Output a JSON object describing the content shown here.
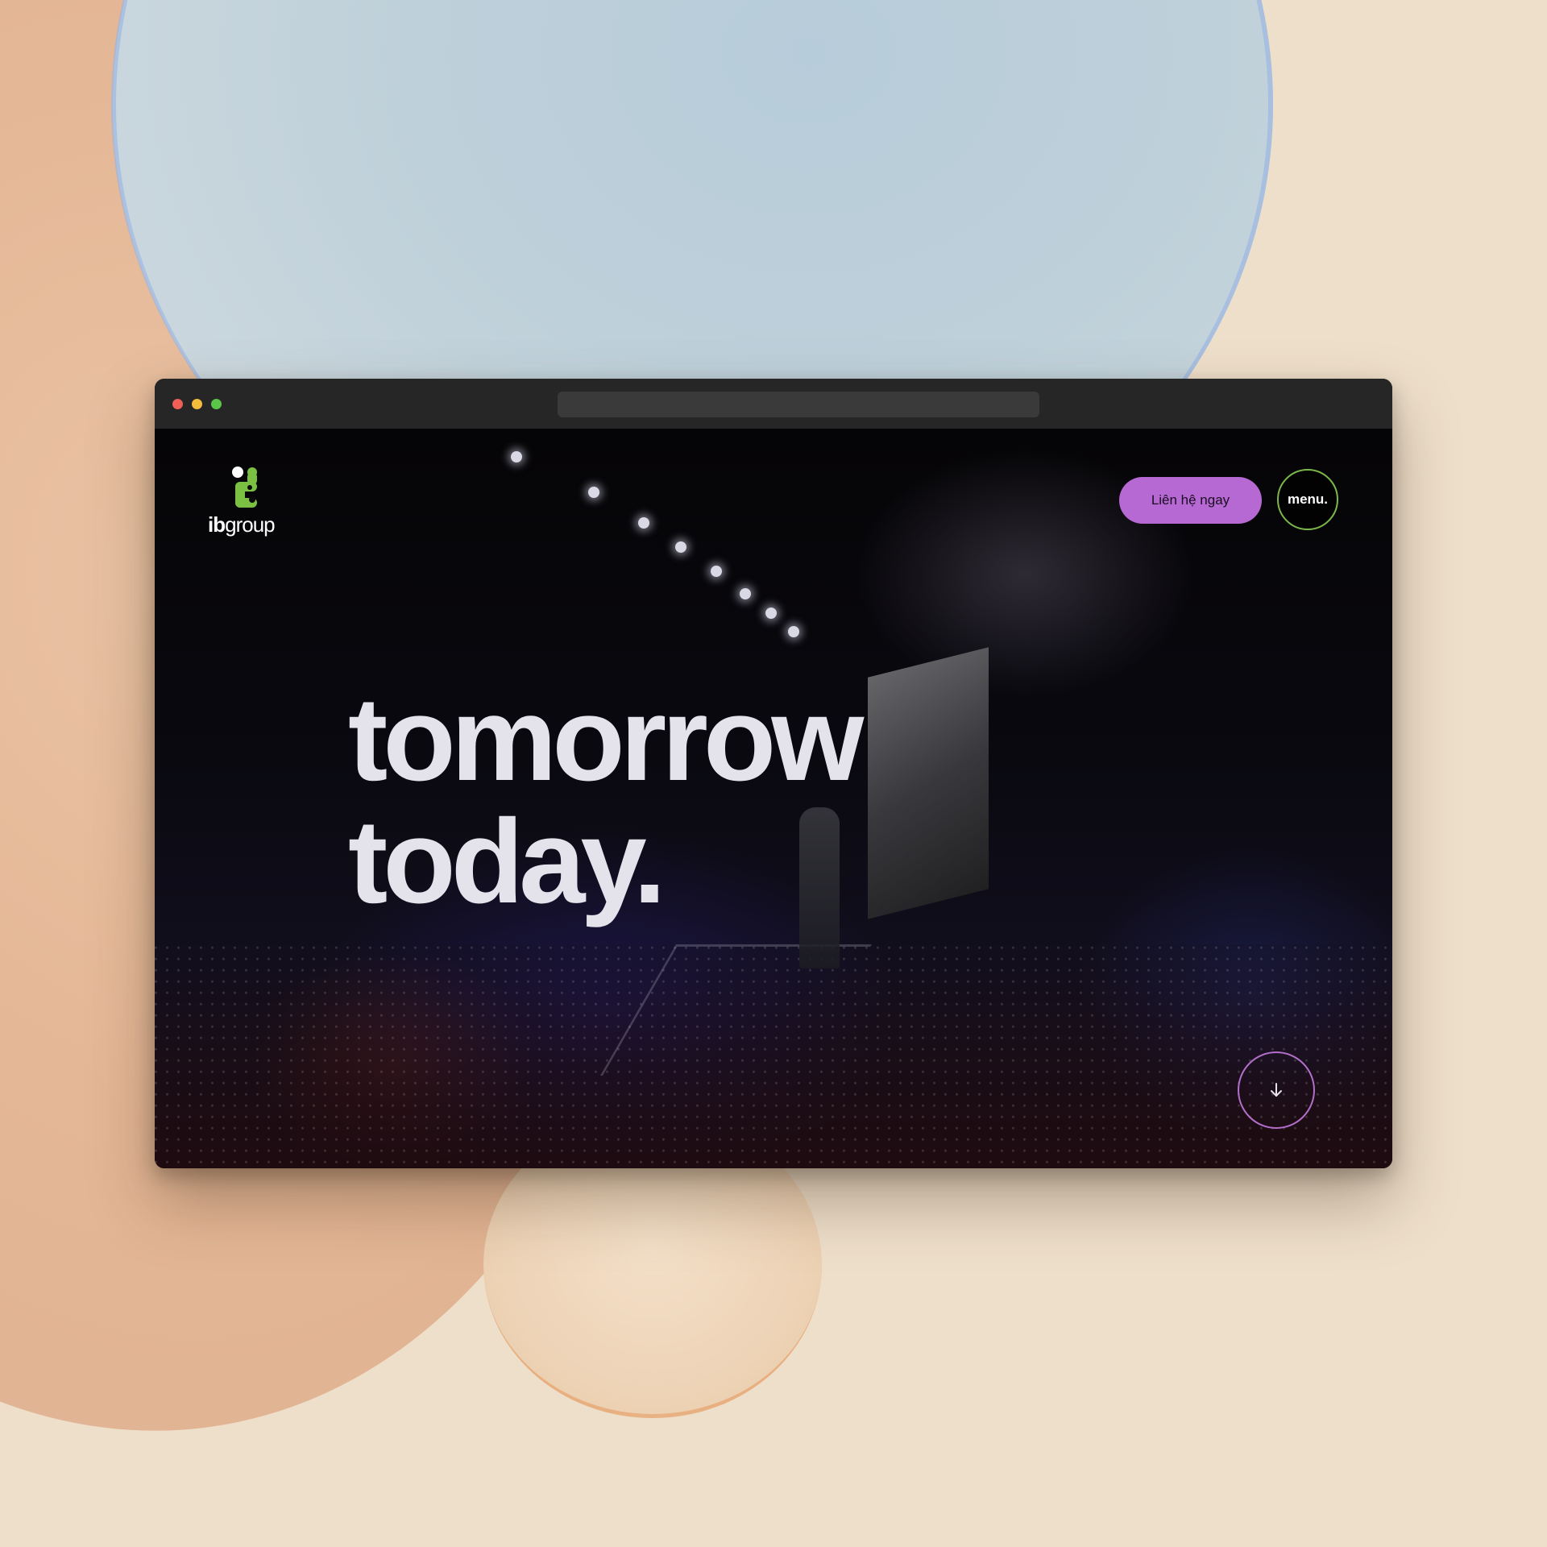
{
  "page": {
    "logo": {
      "mark_colors": {
        "white": "#ffffff",
        "green": "#7bc043"
      },
      "word_bold": "ib",
      "word_regular": "group"
    },
    "header": {
      "cta_label": "Liên hệ ngay",
      "menu_label": "menu."
    },
    "hero": {
      "line1": "tomorrow",
      "line2": "today."
    },
    "scroll_button": {
      "icon": "arrow-down-icon"
    }
  },
  "colors": {
    "cta": "#b769d3",
    "menu_ring": "#7bb84a",
    "scroll_ring": "#b26fc9",
    "hero_text": "#e4e2ea",
    "titlebar": "#262626",
    "backdrop": "#eedfca"
  }
}
